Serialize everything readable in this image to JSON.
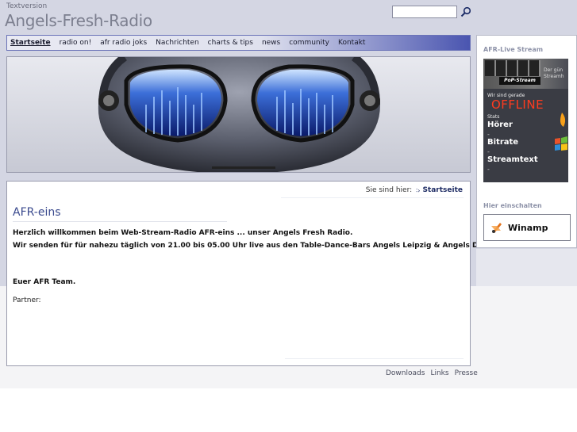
{
  "header": {
    "textversion": "Textversion",
    "site_title": "Angels-Fresh-Radio",
    "search_placeholder": ""
  },
  "nav": {
    "items": [
      {
        "label": "Startseite",
        "active": true
      },
      {
        "label": "radio on!"
      },
      {
        "label": "afr radio joks"
      },
      {
        "label": "Nachrichten"
      },
      {
        "label": "charts & tips"
      },
      {
        "label": "news"
      },
      {
        "label": "community"
      },
      {
        "label": "Kontakt"
      }
    ]
  },
  "content": {
    "breadcrumb_prefix": "Sie sind hier:",
    "breadcrumb_current": "Startseite",
    "heading": "AFR-eins",
    "lines": [
      "Herzlich willkommen beim Web-Stream-Radio AFR-eins ... unser Angels Fresh Radio.",
      "Wir senden für für nahezu täglich von 21.00 bis 05.00 Uhr live aus den Table-Dance-Bars Angels Leipzig & Angels Dresden.",
      "Euer AFR Team."
    ],
    "partner": "Partner:"
  },
  "footer": {
    "links": [
      "Downloads",
      "Links",
      "Presse"
    ]
  },
  "sidebar": {
    "stream_title": "AFR-Live Stream",
    "stream_panel": {
      "tagline": "Der gün",
      "tagline2": "Streamh",
      "badge": "PoP-Stream",
      "status_prefix": "Wir sind gerade",
      "status": "OFFLINE",
      "stats_label": "Stats",
      "rows": [
        "Hörer",
        "Bitrate",
        "Streamtext"
      ]
    },
    "listen_title": "Hier einschalten",
    "player_label": "Winamp"
  },
  "colors": {
    "accent": "#3a4a8e",
    "nav_gradient_end": "#4a55b0",
    "offline": "#ff3b1f"
  }
}
